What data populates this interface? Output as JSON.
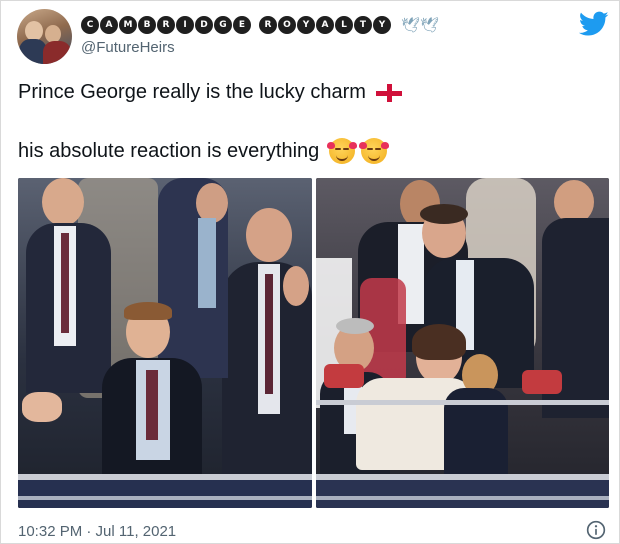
{
  "header": {
    "display_name_words": [
      [
        "C",
        "A",
        "M",
        "B",
        "R",
        "I",
        "D",
        "G",
        "E"
      ],
      [
        "R",
        "O",
        "Y",
        "A",
        "L",
        "T",
        "Y"
      ]
    ],
    "display_name_suffix": "🕊🕊",
    "handle": "@FutureHeirs",
    "twitter_icon": "twitter-bird-icon",
    "avatar_icon": "profile-avatar"
  },
  "tweet": {
    "line1": "Prince George really is the lucky charm",
    "line2": "his absolute reaction is everything",
    "line1_emoji": "england-flag",
    "line2_emoji": "smiling-face-with-hearts"
  },
  "media": {
    "left_photo": "crowd-celebrating-photo",
    "right_photo": "crowd-hugging-photo"
  },
  "footer": {
    "timestamp": "10:32 PM · Jul 11, 2021",
    "info_icon": "info-icon"
  },
  "colors": {
    "twitter_blue": "#1d9bf0",
    "muted_text": "#536471",
    "flag_red": "#d0103a"
  }
}
